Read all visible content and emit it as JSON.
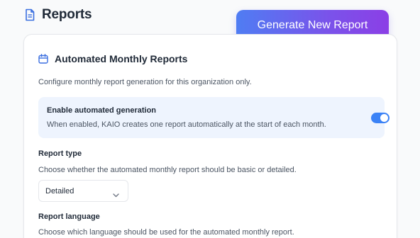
{
  "header": {
    "title": "Reports",
    "title_icon": "document-icon",
    "generate_button_label": "Generate New Report"
  },
  "card": {
    "title": "Automated Monthly Reports",
    "title_icon": "calendar-icon",
    "description": "Configure monthly report generation for this organization only.",
    "automation": {
      "title": "Enable automated generation",
      "description": "When enabled, KAIO creates one report automatically at the start of each month.",
      "enabled": true
    },
    "report_type": {
      "label": "Report type",
      "description": "Choose whether the automated monthly report should be basic or detailed.",
      "selected": "Detailed"
    },
    "report_language": {
      "label": "Report language",
      "description": "Choose which language should be used for the automated monthly report."
    }
  },
  "colors": {
    "accent": "#3b82f6",
    "button_gradient_start": "#4f7df3",
    "button_gradient_end": "#8b3fe6",
    "panel_bg": "#eef4fe"
  }
}
